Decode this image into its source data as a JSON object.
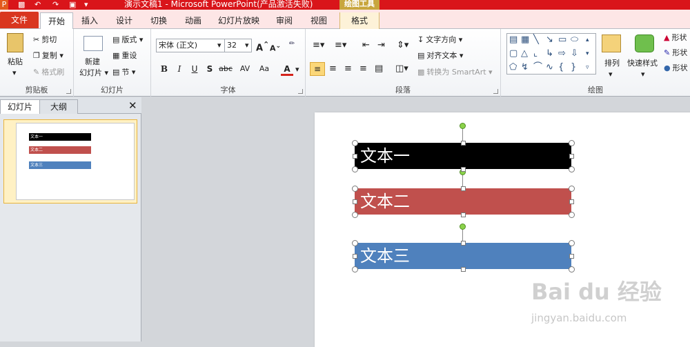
{
  "window": {
    "title": "演示文稿1 - Microsoft PowerPoint(产品激活失败)",
    "tools_label": "绘图工具"
  },
  "tabs": {
    "file": "文件",
    "home": "开始",
    "insert": "插入",
    "design": "设计",
    "transitions": "切换",
    "animations": "动画",
    "slideshow": "幻灯片放映",
    "review": "审阅",
    "view": "视图",
    "format": "格式"
  },
  "clipboard": {
    "paste": "粘贴",
    "cut": "剪切",
    "copy": "复制",
    "format_painter": "格式刷",
    "label": "剪贴板"
  },
  "slides": {
    "new_slide": "新建",
    "new_slide2": "幻灯片",
    "layout": "版式",
    "reset": "重设",
    "section": "节",
    "label": "幻灯片"
  },
  "font": {
    "name": "宋体 (正文)",
    "size": "32",
    "label": "字体",
    "bold": "B",
    "italic": "I",
    "underline": "U",
    "shadow": "S",
    "strike": "abc",
    "spacing": "AV",
    "case": "Aa",
    "color": "A",
    "grow": "A",
    "shrink": "A"
  },
  "paragraph": {
    "text_direction": "文字方向",
    "align_text": "对齐文本",
    "smartart": "转换为 SmartArt",
    "label": "段落"
  },
  "drawing": {
    "arrange": "排列",
    "quick_styles": "快速样式",
    "shape_fill": "形状",
    "shape_outline": "形状",
    "shape_effects": "形状",
    "label": "绘图"
  },
  "panel": {
    "tab_slides": "幻灯片",
    "tab_outline": "大纲",
    "slide_number": "1"
  },
  "shapes": [
    {
      "text": "文本一",
      "color": "#000000"
    },
    {
      "text": "文本二",
      "color": "#c0504d"
    },
    {
      "text": "文本三",
      "color": "#4f81bd"
    }
  ],
  "watermark": {
    "logo": "Bai du 经验",
    "url": "jingyan.baidu.com"
  }
}
